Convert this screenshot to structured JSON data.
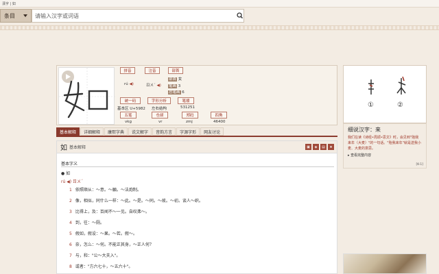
{
  "topstrip": {
    "text": "漢字 | 如"
  },
  "search": {
    "dropdown_label": "条目",
    "placeholder": "请输入汉字或词语"
  },
  "char": {
    "pinyin_line": "rú",
    "zhuyin": "ㄖㄨˊ",
    "radical_label": "部首",
    "radical_value": "女",
    "strokes_label": "笔画",
    "strokes_value": "3",
    "total_label": "总笔画",
    "total_value": "6",
    "unicode": "基本区 U+5982",
    "structure": "左右结构",
    "code": "531251",
    "wubi": "vkg",
    "cangjie": "vr",
    "zhengma": "zmj",
    "sijiao": "46400"
  },
  "buttons": {
    "pinyin": "拼音",
    "zhuyin": "注音",
    "radical": "部首",
    "unicode": "统一码",
    "stroke_analysis": "字形分析",
    "bishun": "笔顺",
    "wubi": "五笔",
    "cangjie": "仓颉",
    "zhengma": "郑码",
    "sijiao": "四角"
  },
  "tabs": [
    "基本解释",
    "详细解释",
    "康熙字典",
    "说文解字",
    "音韵方言",
    "字源字形",
    "网友讨论"
  ],
  "content": {
    "char": "如",
    "heading": "基本解释",
    "section_title": "基本字义",
    "entry_char": "● 如",
    "entry_pinyin": "rú ◀) ㄖㄨˊ",
    "defs": [
      {
        "num": "1",
        "text": "依照顺从：～意。～願。～法炮制。"
      },
      {
        "num": "2",
        "text": "像，相似，同什么一样：～此。～是。～同。～故。～初。谈人～织。"
      },
      {
        "num": "3",
        "text": "比得上，及：百闻不～一见。自叹弗～。"
      },
      {
        "num": "4",
        "text": "到，往：～厕。"
      },
      {
        "num": "5",
        "text": "假如，假设：～果。～若。假～。"
      },
      {
        "num": "6",
        "text": "奈，怎么：～何。不能正其身，～正人何？"
      },
      {
        "num": "7",
        "text": "与，和：\"公～大夫入\"。"
      },
      {
        "num": "8",
        "text": "或者：\"方六七十，～五六十\"。"
      }
    ]
  },
  "right": {
    "stroke_labels": [
      "①",
      "②"
    ],
    "title": "细说汉字：来",
    "text": "我们在读《诗经•周颂•思文》时，会见到\"贻我来牟（大麦）\"的一句话。\"贻我来牟\"就是送我小麦、大麦的意思。",
    "more": "▸ 查看完整内容",
    "page": "[K-1]"
  },
  "colors": {
    "accent": "#8a3a2d",
    "tag": "#a0392b"
  }
}
